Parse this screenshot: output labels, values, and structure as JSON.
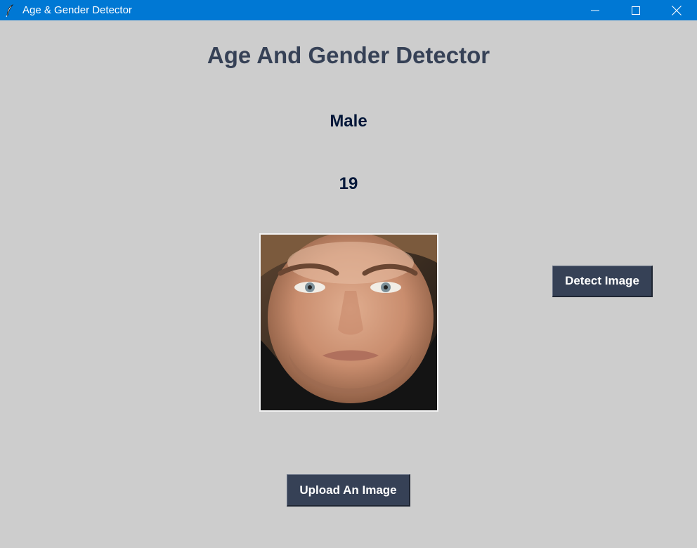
{
  "window": {
    "title": "Age & Gender Detector",
    "icon": "feather-icon",
    "controls": [
      "minimize-icon",
      "maximize-icon",
      "close-icon"
    ]
  },
  "main": {
    "heading": "Age And Gender Detector",
    "gender": "Male",
    "age": "19",
    "image": "face-photo"
  },
  "buttons": {
    "detect_label": "Detect Image",
    "upload_label": "Upload An Image"
  },
  "colors": {
    "titlebar": "#0078d4",
    "background": "#cdcdcd",
    "heading": "#364156",
    "result_text": "#011638",
    "button_bg": "#364156",
    "button_text": "#ffffff"
  }
}
